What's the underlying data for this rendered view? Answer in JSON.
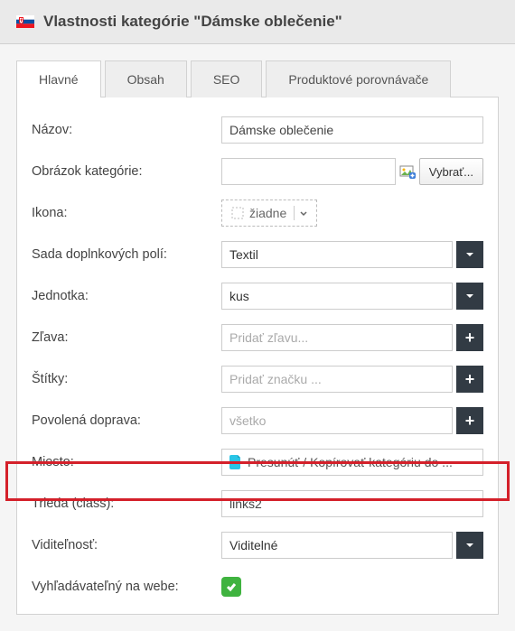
{
  "header": {
    "title": "Vlastnosti kategórie \"Dámske oblečenie\""
  },
  "tabs": [
    "Hlavné",
    "Obsah",
    "SEO",
    "Produktové porovnávače"
  ],
  "rows": {
    "name": {
      "label": "Názov:",
      "value": "Dámske oblečenie"
    },
    "image": {
      "label": "Obrázok kategórie:",
      "button": "Vybrať..."
    },
    "icon": {
      "label": "Ikona:",
      "value": "žiadne"
    },
    "fieldset": {
      "label": "Sada doplnkových polí:",
      "value": "Textil"
    },
    "unit": {
      "label": "Jednotka:",
      "value": "kus"
    },
    "discount": {
      "label": "Zľava:",
      "placeholder": "Pridať zľavu..."
    },
    "tags": {
      "label": "Štítky:",
      "placeholder": "Pridať značku ..."
    },
    "shipping": {
      "label": "Povolená doprava:",
      "placeholder": "všetko"
    },
    "place": {
      "label": "Miesto:",
      "value": "Presunúť / Kopírovať kategóriu do ..."
    },
    "class": {
      "label": "Trieda (class):",
      "value": "links2"
    },
    "visibility": {
      "label": "Viditeľnosť:",
      "value": "Viditelné"
    },
    "searchable": {
      "label": "Vyhľadávateľný na webe:",
      "checked": true
    }
  }
}
